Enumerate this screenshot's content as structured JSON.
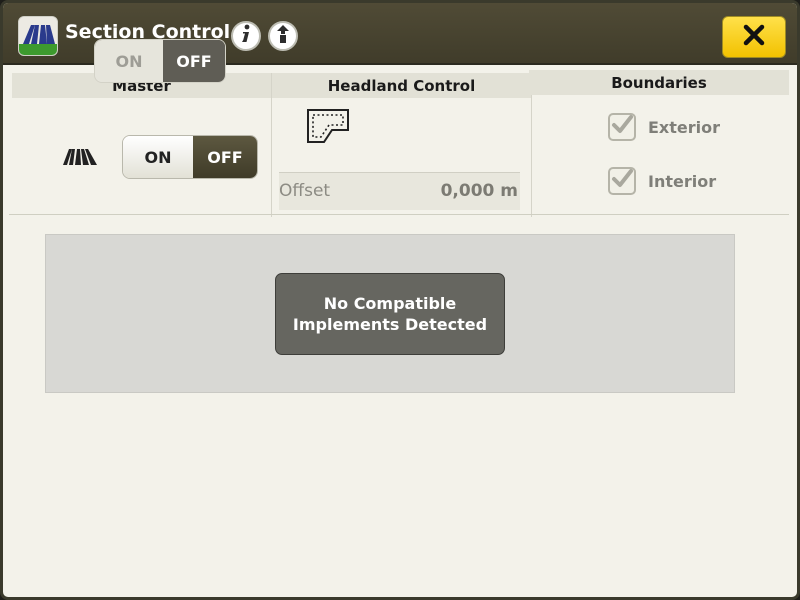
{
  "window": {
    "title": "Section Control"
  },
  "icons": {
    "app": "section-control-app-icon",
    "info": "info-icon",
    "info_alt": "info-up-arrow-icon",
    "close": "close-x-icon",
    "master": "section-control-sections-icon",
    "headland": "headland-boundary-icon",
    "check": "checkmark-icon"
  },
  "master": {
    "header": "Master",
    "toggle": {
      "on_label": "ON",
      "off_label": "OFF",
      "selected": "OFF"
    }
  },
  "headland": {
    "header": "Headland Control",
    "toggle": {
      "on_label": "ON",
      "off_label": "OFF",
      "selected": "OFF"
    },
    "offset": {
      "label": "Offset",
      "value": "0,000 m"
    }
  },
  "boundaries": {
    "header": "Boundaries",
    "items": [
      {
        "label": "Exterior",
        "checked": true
      },
      {
        "label": "Interior",
        "checked": true
      }
    ]
  },
  "message": {
    "line1": "No Compatible",
    "line2": "Implements Detected"
  },
  "colors": {
    "titlebar": "#4a4532",
    "close_button": "#f5c800",
    "toggle_selected": "#4e4a36",
    "message_box": "#666660"
  }
}
